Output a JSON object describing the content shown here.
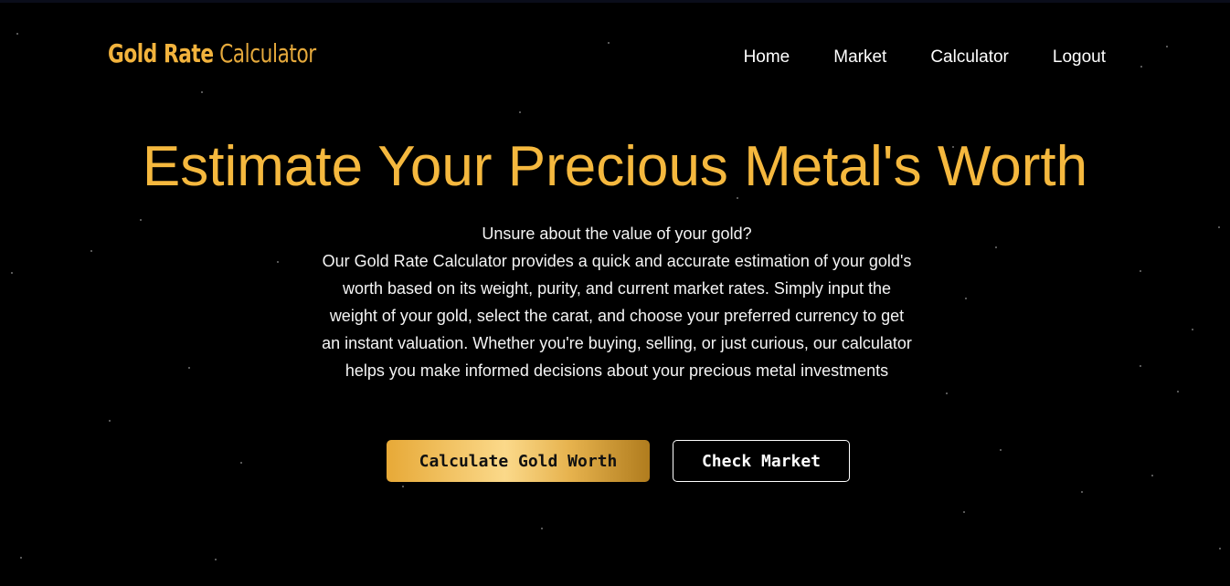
{
  "brand": {
    "name_bold": "Gold Rate",
    "name_light": "Calculator",
    "color": "#f2b33d"
  },
  "nav": {
    "items": [
      {
        "label": "Home"
      },
      {
        "label": "Market"
      },
      {
        "label": "Calculator"
      },
      {
        "label": "Logout"
      }
    ]
  },
  "hero": {
    "title": "Estimate Your Precious Metal's Worth",
    "title_color": "#f5b83e",
    "lead": "Unsure about the value of your gold?",
    "body": "Our Gold Rate Calculator provides a quick and accurate estimation of your gold's worth based on its weight, purity, and current market rates. Simply input the weight of your gold, select the carat, and choose your preferred currency to get an instant valuation. Whether you're buying, selling, or just curious, our calculator helps you make informed decisions about your precious metal investments"
  },
  "actions": {
    "primary_label": "Calculate Gold Worth",
    "secondary_label": "Check Market"
  },
  "colors": {
    "background": "#000000",
    "text": "#ffffff"
  }
}
